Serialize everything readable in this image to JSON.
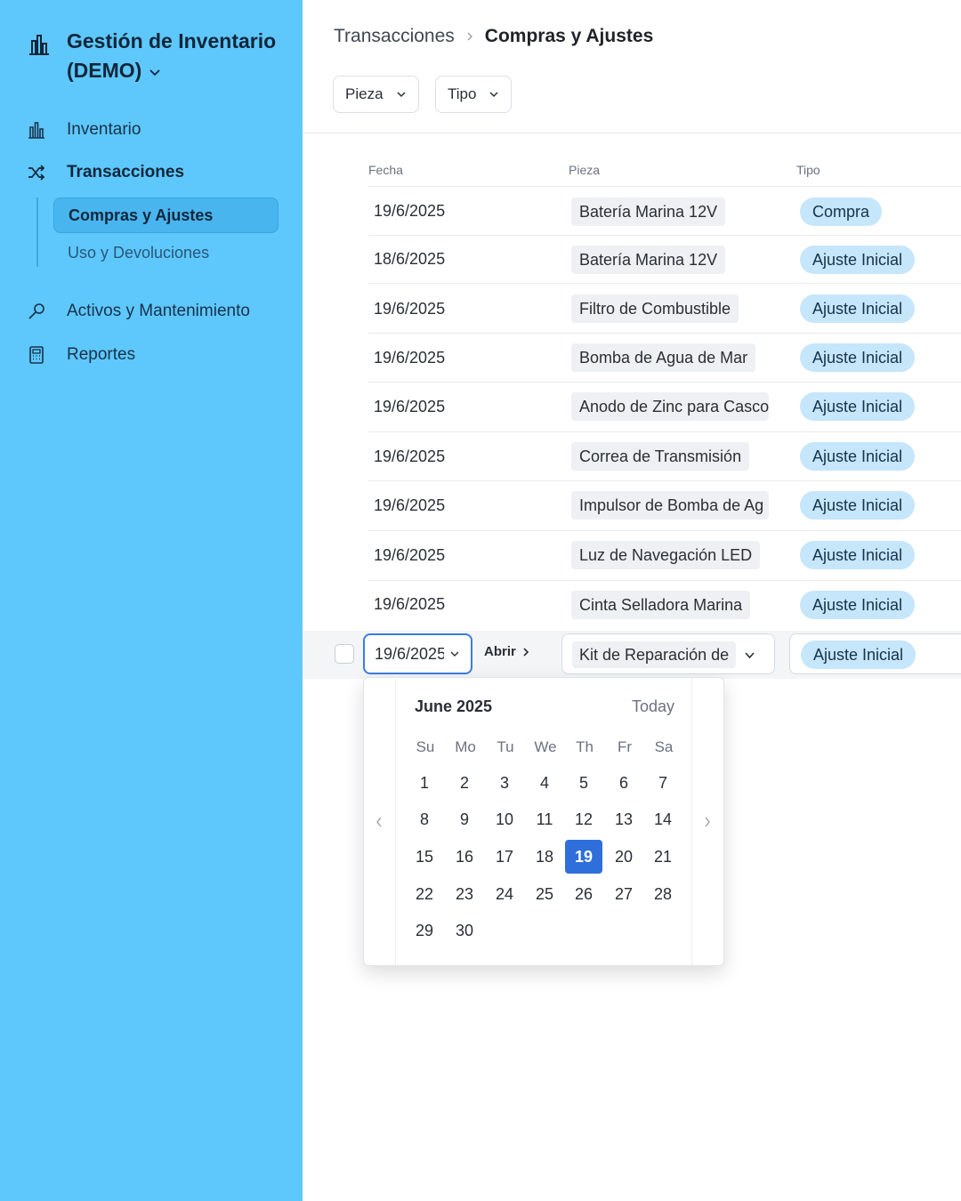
{
  "sidebar": {
    "app_title": "Gestión de Inventario (DEMO)",
    "items": [
      {
        "label": "Inventario",
        "icon": "chart-bars-icon"
      },
      {
        "label": "Transacciones",
        "icon": "shuffle-icon"
      },
      {
        "label": "Activos y Mantenimiento",
        "icon": "wrench-icon"
      },
      {
        "label": "Reportes",
        "icon": "calculator-icon"
      }
    ],
    "subitems": [
      {
        "label": "Compras y Ajustes",
        "active": true
      },
      {
        "label": "Uso y Devoluciones",
        "active": false
      }
    ],
    "accent_color": "#5ec8fc"
  },
  "header": {
    "breadcrumb": [
      "Transacciones",
      "Compras y Ajustes"
    ],
    "filters": [
      "Pieza",
      "Tipo"
    ]
  },
  "table": {
    "columns": [
      "Fecha",
      "Pieza",
      "Tipo"
    ],
    "rows": [
      {
        "fecha": "19/6/2025",
        "pieza": "Batería Marina 12V",
        "tipo": "Compra"
      },
      {
        "fecha": "18/6/2025",
        "pieza": "Batería Marina 12V",
        "tipo": "Ajuste Inicial"
      },
      {
        "fecha": "19/6/2025",
        "pieza": "Filtro de Combustible",
        "tipo": "Ajuste Inicial"
      },
      {
        "fecha": "19/6/2025",
        "pieza": "Bomba de Agua de Mar",
        "tipo": "Ajuste Inicial"
      },
      {
        "fecha": "19/6/2025",
        "pieza": "Anodo de Zinc para Casco",
        "tipo": "Ajuste Inicial"
      },
      {
        "fecha": "19/6/2025",
        "pieza": "Correa de Transmisión",
        "tipo": "Ajuste Inicial"
      },
      {
        "fecha": "19/6/2025",
        "pieza": "Impulsor de Bomba de Ag",
        "tipo": "Ajuste Inicial"
      },
      {
        "fecha": "19/6/2025",
        "pieza": "Luz de Navegación LED",
        "tipo": "Ajuste Inicial"
      },
      {
        "fecha": "19/6/2025",
        "pieza": "Cinta Selladora Marina",
        "tipo": "Ajuste Inicial"
      }
    ],
    "edit_row": {
      "fecha": "19/6/2025",
      "open_label": "Abrir",
      "pieza": "Kit de Reparación de",
      "tipo": "Ajuste Inicial"
    }
  },
  "calendar": {
    "month_label": "June 2025",
    "today_label": "Today",
    "weekdays": [
      "Su",
      "Mo",
      "Tu",
      "We",
      "Th",
      "Fr",
      "Sa"
    ],
    "days": [
      "1",
      "2",
      "3",
      "4",
      "5",
      "6",
      "7",
      "8",
      "9",
      "10",
      "11",
      "12",
      "13",
      "14",
      "15",
      "16",
      "17",
      "18",
      "19",
      "20",
      "21",
      "22",
      "23",
      "24",
      "25",
      "26",
      "27",
      "28",
      "29",
      "30"
    ],
    "selected_day": "19",
    "selected_color": "#2f6fdc"
  }
}
